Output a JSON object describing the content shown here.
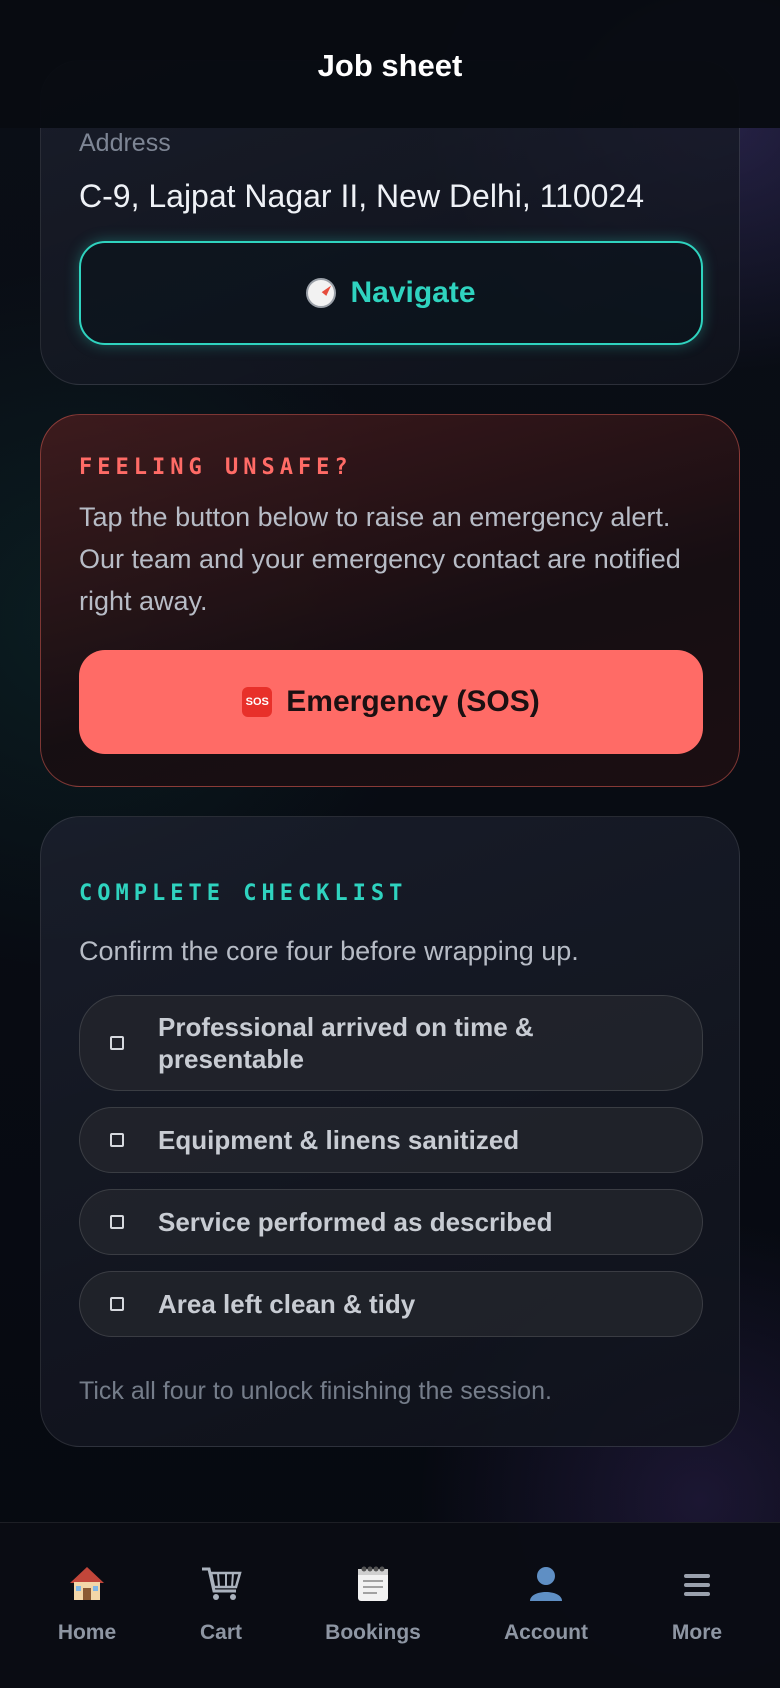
{
  "header": {
    "title": "Job sheet"
  },
  "address_card": {
    "label": "Address",
    "value": "C-9, Lajpat Nagar II, New Delhi, 110024",
    "navigate_label": "Navigate",
    "navigate_icon": "compass-icon"
  },
  "sos_card": {
    "title": "FEELING UNSAFE?",
    "text": "Tap the button below to raise an emergency alert. Our team and your emergency contact are notified right away.",
    "button_label": "Emergency (SOS)",
    "button_icon": "sos-icon",
    "accent": "#ff6b66"
  },
  "checklist_card": {
    "title": "COMPLETE CHECKLIST",
    "subtitle": "Confirm the core four before wrapping up.",
    "items": [
      {
        "label": "Professional arrived on time & presentable",
        "checked": false
      },
      {
        "label": "Equipment & linens sanitized",
        "checked": false
      },
      {
        "label": "Service performed as described",
        "checked": false
      },
      {
        "label": "Area left clean & tidy",
        "checked": false
      }
    ],
    "footer": "Tick all four to unlock finishing the session.",
    "accent": "#2fd3bf"
  },
  "bottom_nav": {
    "items": [
      {
        "label": "Home",
        "icon": "house-icon"
      },
      {
        "label": "Cart",
        "icon": "cart-icon"
      },
      {
        "label": "Bookings",
        "icon": "notepad-icon"
      },
      {
        "label": "Account",
        "icon": "user-icon"
      },
      {
        "label": "More",
        "icon": "menu-icon"
      }
    ]
  }
}
